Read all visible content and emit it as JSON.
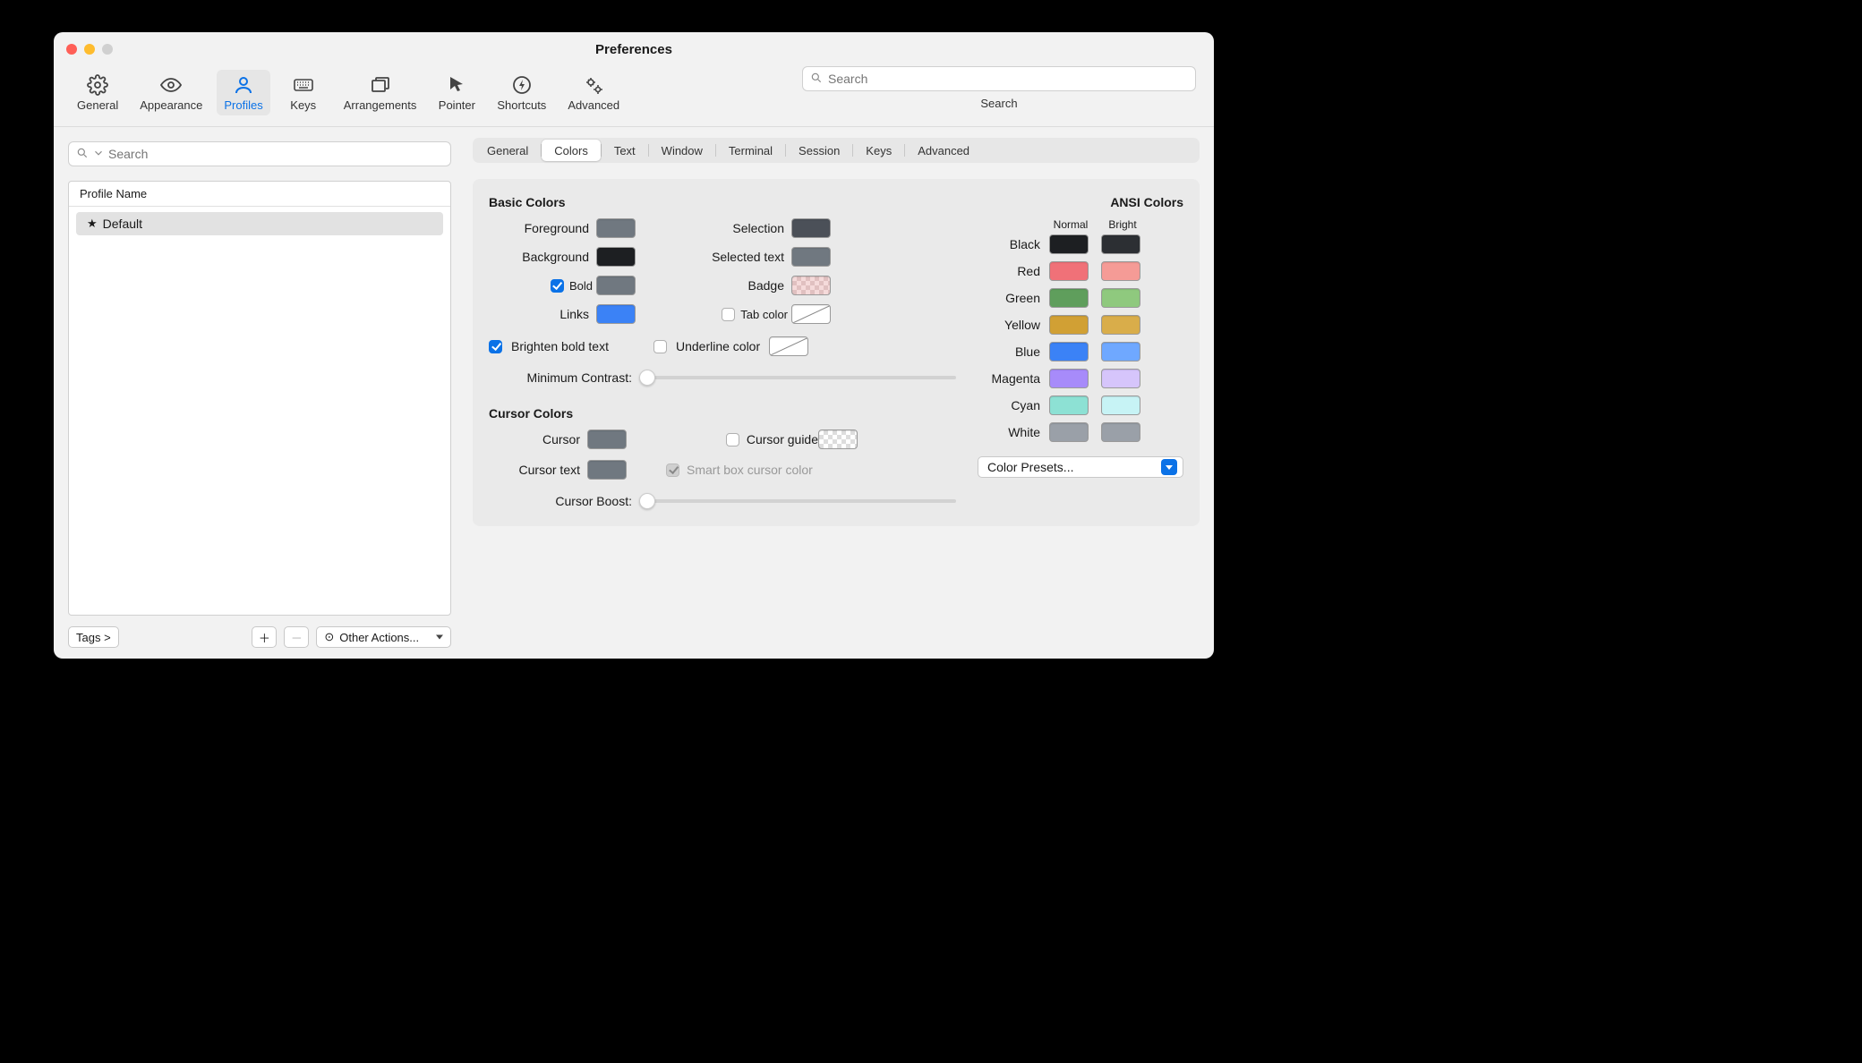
{
  "window": {
    "title": "Preferences"
  },
  "toolbar": {
    "items": [
      {
        "label": "General"
      },
      {
        "label": "Appearance"
      },
      {
        "label": "Profiles"
      },
      {
        "label": "Keys"
      },
      {
        "label": "Arrangements"
      },
      {
        "label": "Pointer"
      },
      {
        "label": "Shortcuts"
      },
      {
        "label": "Advanced"
      }
    ],
    "search_placeholder": "Search",
    "search_caption": "Search"
  },
  "sidebar": {
    "search_placeholder": "Search",
    "list_header": "Profile Name",
    "rows": [
      {
        "name": "Default"
      }
    ],
    "tags_label": "Tags >",
    "other_actions_label": "Other Actions..."
  },
  "subtabs": [
    "General",
    "Colors",
    "Text",
    "Window",
    "Terminal",
    "Session",
    "Keys",
    "Advanced"
  ],
  "basic_colors": {
    "title": "Basic Colors",
    "foreground": {
      "label": "Foreground",
      "color": "#707880"
    },
    "background": {
      "label": "Background",
      "color": "#1d1f22"
    },
    "bold": {
      "label": "Bold",
      "checked": true,
      "color": "#707880"
    },
    "links": {
      "label": "Links",
      "color": "#3b82f6"
    },
    "selection": {
      "label": "Selection",
      "color": "#4b5058"
    },
    "selected_text": {
      "label": "Selected text",
      "color": "#707880"
    },
    "badge": {
      "label": "Badge"
    },
    "tab_color": {
      "label": "Tab color",
      "checked": false
    },
    "underline": {
      "label": "Underline color",
      "checked": false
    },
    "brighten": {
      "label": "Brighten bold text",
      "checked": true
    },
    "min_contrast_label": "Minimum Contrast:"
  },
  "cursor_colors": {
    "title": "Cursor Colors",
    "cursor": {
      "label": "Cursor",
      "color": "#707880"
    },
    "cursor_text": {
      "label": "Cursor text",
      "color": "#707880"
    },
    "guide": {
      "label": "Cursor guide",
      "checked": false
    },
    "smart_box": {
      "label": "Smart box cursor color",
      "checked": true,
      "disabled": true
    },
    "boost_label": "Cursor Boost:"
  },
  "ansi": {
    "title": "ANSI Colors",
    "normal_label": "Normal",
    "bright_label": "Bright",
    "rows": [
      {
        "label": "Black",
        "normal": "#1d1f22",
        "bright": "#2c2f33"
      },
      {
        "label": "Red",
        "normal": "#f07178",
        "bright": "#f59b96"
      },
      {
        "label": "Green",
        "normal": "#5f9e5c",
        "bright": "#8fc97e"
      },
      {
        "label": "Yellow",
        "normal": "#d1a034",
        "bright": "#d9ad4a"
      },
      {
        "label": "Blue",
        "normal": "#3b82f6",
        "bright": "#6fa8ff"
      },
      {
        "label": "Magenta",
        "normal": "#a78bfa",
        "bright": "#d6c5fb"
      },
      {
        "label": "Cyan",
        "normal": "#8de1d4",
        "bright": "#c7f3f5"
      },
      {
        "label": "White",
        "normal": "#9aa0a8",
        "bright": "#9aa0a8"
      }
    ]
  },
  "presets_label": "Color Presets..."
}
